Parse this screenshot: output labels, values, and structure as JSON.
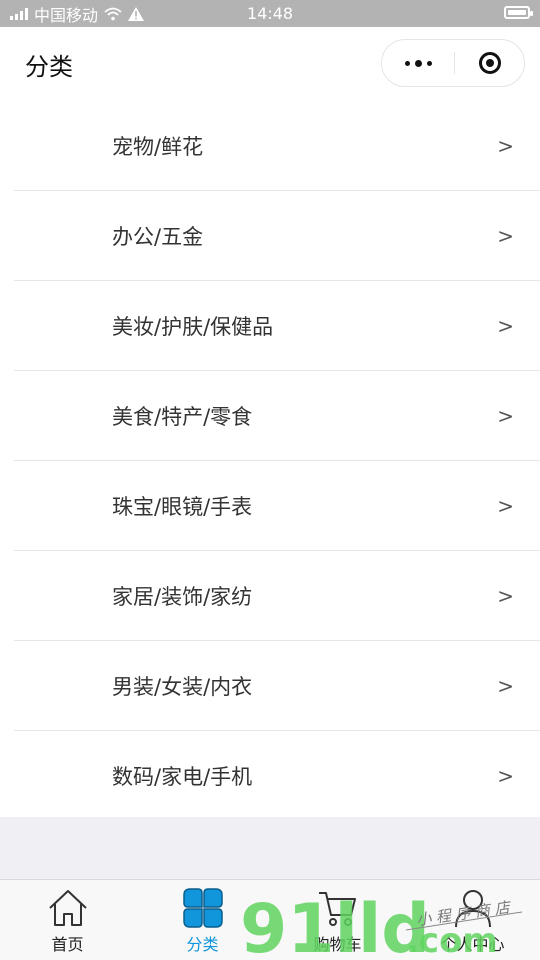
{
  "status_bar": {
    "carrier": "中国移动",
    "time": "14:48",
    "icons": [
      "signal-icon",
      "wifi-icon",
      "warning-icon",
      "battery-icon"
    ]
  },
  "header": {
    "title": "分类",
    "menu_icon": "more-dots-icon",
    "close_icon": "target-close-icon"
  },
  "categories": [
    {
      "label": "宠物/鲜花",
      "arrow": ">"
    },
    {
      "label": "办公/五金",
      "arrow": ">"
    },
    {
      "label": "美妆/护肤/保健品",
      "arrow": ">"
    },
    {
      "label": "美食/特产/零食",
      "arrow": ">"
    },
    {
      "label": "珠宝/眼镜/手表",
      "arrow": ">"
    },
    {
      "label": "家居/装饰/家纺",
      "arrow": ">"
    },
    {
      "label": "男装/女装/内衣",
      "arrow": ">"
    },
    {
      "label": "数码/家电/手机",
      "arrow": ">"
    }
  ],
  "tabbar": {
    "tabs": [
      {
        "label": "首页",
        "icon": "home-icon",
        "active": false
      },
      {
        "label": "分类",
        "icon": "category-icon",
        "active": true
      },
      {
        "label": "购物车",
        "icon": "cart-icon",
        "active": false
      },
      {
        "label": "个人中心",
        "icon": "user-icon",
        "active": false
      }
    ]
  },
  "colors": {
    "accent": "#1296db",
    "status_bar": "#b3b3b3",
    "page_bg": "#efeff4",
    "watermark_green": "#5fd35f"
  },
  "watermark": {
    "text": "91lld.com",
    "handwritten": "小程序商店"
  }
}
